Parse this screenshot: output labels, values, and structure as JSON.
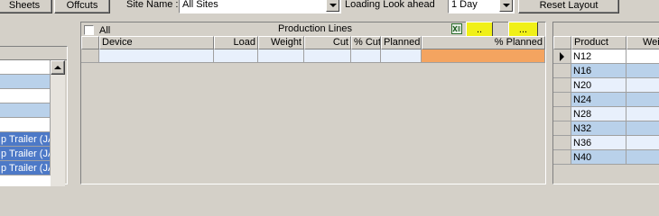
{
  "toolbar": {
    "sheets_label": "Sheets",
    "offcuts_label": "Offcuts",
    "site_name_label": "Site Name :",
    "site_name_value": "All Sites",
    "loading_look_ahead_label": "Loading Look ahead",
    "look_ahead_value": "1 Day",
    "reset_layout_label": "Reset Layout"
  },
  "left_panel": {
    "rows": [
      {
        "text": "",
        "selected": false
      },
      {
        "text": "",
        "selected": true
      },
      {
        "text": "",
        "selected": false
      },
      {
        "text": "",
        "selected": true
      },
      {
        "text": "",
        "selected": false
      },
      {
        "text": "p Trailer  (JA",
        "selected": true
      },
      {
        "text": "p Trailer  (JA",
        "selected": true
      },
      {
        "text": "p Trailer  (JA",
        "selected": true
      }
    ]
  },
  "production": {
    "title": "Production Lines",
    "all_label": "All",
    "button1_label": "..",
    "button2_label": "...",
    "columns": [
      "Device",
      "Load",
      "Weight",
      "Cut",
      "% Cut",
      "Planned",
      "% Planned"
    ],
    "accent_color": "#f4a460",
    "highlight_color": "#f0f018"
  },
  "products": {
    "columns": [
      "Product",
      "Wei"
    ],
    "rows": [
      "N12",
      "N16",
      "N20",
      "N24",
      "N28",
      "N32",
      "N36",
      "N40"
    ]
  }
}
